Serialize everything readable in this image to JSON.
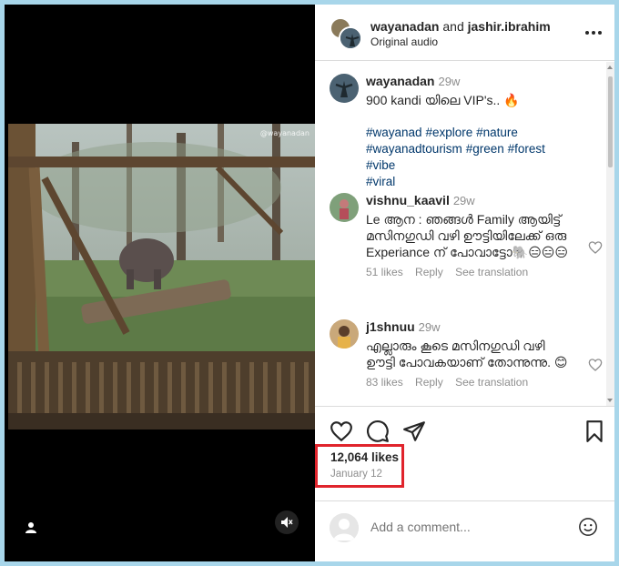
{
  "media": {
    "watermark": "@wayanadan"
  },
  "header": {
    "user_primary": "wayanadan",
    "joiner": "and",
    "user_secondary": "jashir.ibrahim",
    "audio": "Original audio"
  },
  "caption": {
    "username": "wayanadan",
    "time": "29w",
    "text": "900 kandi യിലെ VIP's.. 🔥",
    "hashtags": [
      "#wayanad",
      "#explore",
      "#nature",
      "#wayanadtourism",
      "#green",
      "#forest",
      "#vibe",
      "#viral"
    ]
  },
  "comments": [
    {
      "username": "vishnu_kaavil",
      "time": "29w",
      "text": "Le ആന : ഞങ്ങൾ Family ആയിട്ട് മസിനഗുഡി വഴി ഊട്ടിയിലേക്ക് ഒരു Experiance ന് പോവാട്ടോ🐘😑😑😑",
      "likes": "51 likes",
      "reply": "Reply",
      "translate": "See translation"
    },
    {
      "username": "j1shnuu",
      "time": "29w",
      "text": "എല്ലാരും കൂടെ മസിനഗുഡി വഴി ഊട്ടി പോവകയാണ് തോന്നുന്നു. 😊",
      "likes": "83 likes",
      "reply": "Reply",
      "translate": "See translation"
    }
  ],
  "stats": {
    "likes": "12,064 likes",
    "date": "January 12"
  },
  "add_comment": {
    "placeholder": "Add a comment..."
  },
  "icons": {
    "like": "heart-icon",
    "comment": "comment-icon",
    "share": "share-icon",
    "save": "bookmark-icon",
    "emoji": "emoji-icon",
    "more": "more-options-icon",
    "mute": "muted-speaker-icon",
    "user_tag": "user-tag-icon"
  },
  "colors": {
    "highlight_border": "#e0242c",
    "link": "#00376b",
    "muted_text": "#8e8e8e",
    "frame": "#a8d6ea"
  }
}
